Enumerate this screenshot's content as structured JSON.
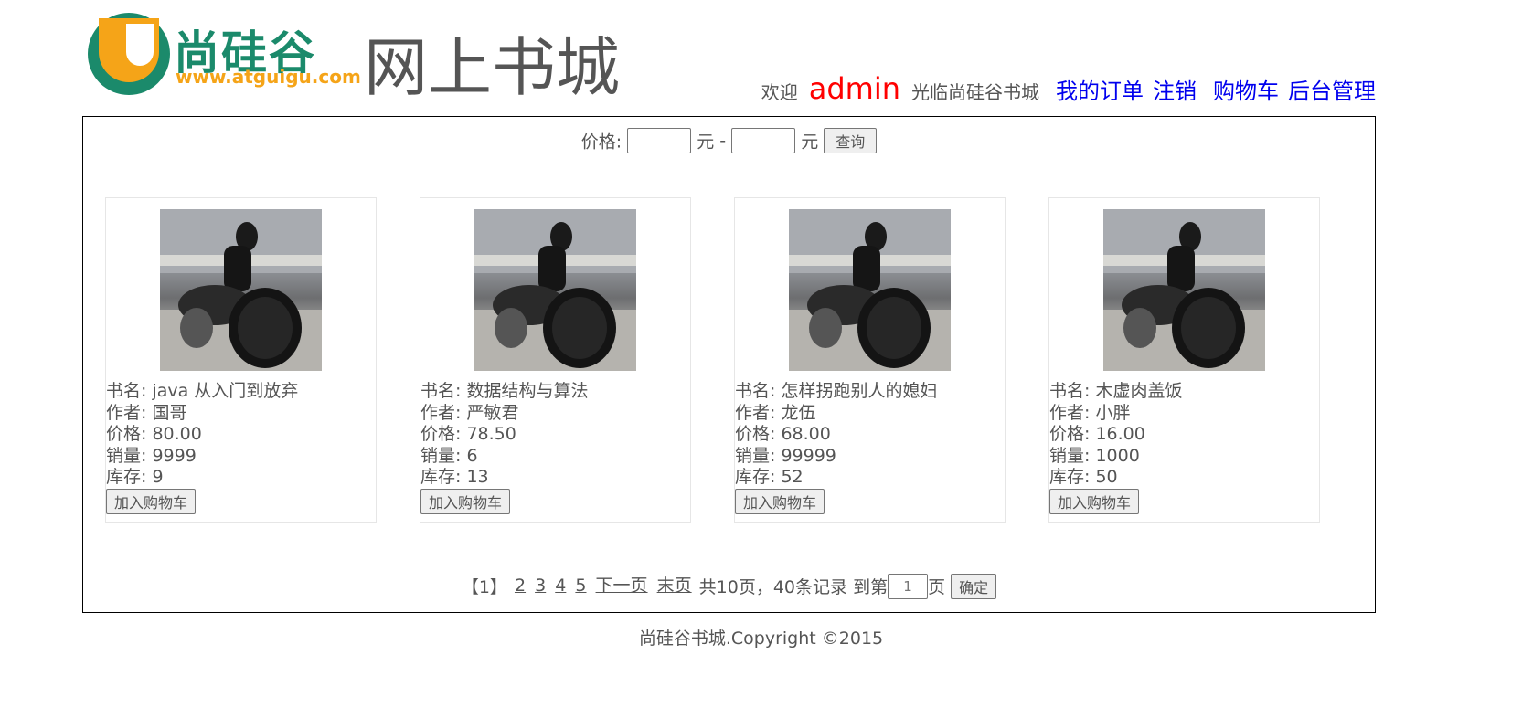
{
  "header": {
    "logo_cn": "尚硅谷",
    "logo_url": "www.atguigu.com",
    "site_title": "网上书城",
    "welcome": "欢迎",
    "username": "admin",
    "welcome_suffix": "光临尚硅谷书城",
    "links": {
      "my_orders": "我的订单",
      "logout": "注销",
      "cart": "购物车",
      "admin": "后台管理"
    },
    "colors": {
      "username": "#ff0000",
      "links": "#0000ee"
    }
  },
  "search": {
    "label": "价格:",
    "unit": "元",
    "separator": "-",
    "min_value": "",
    "max_value": "",
    "button": "查询"
  },
  "books": [
    {
      "name_label": "书名:",
      "name": "java 从入门到放弃",
      "author_label": "作者:",
      "author": "国哥",
      "price_label": "价格:",
      "price": "80.00",
      "sales_label": "销量:",
      "sales": "9999",
      "stock_label": "库存:",
      "stock": "9",
      "button": "加入购物车"
    },
    {
      "name_label": "书名:",
      "name": "数据结构与算法",
      "author_label": "作者:",
      "author": "严敏君",
      "price_label": "价格:",
      "price": "78.50",
      "sales_label": "销量:",
      "sales": "6",
      "stock_label": "库存:",
      "stock": "13",
      "button": "加入购物车"
    },
    {
      "name_label": "书名:",
      "name": "怎样拐跑别人的媳妇",
      "author_label": "作者:",
      "author": "龙伍",
      "price_label": "价格:",
      "price": "68.00",
      "sales_label": "销量:",
      "sales": "99999",
      "stock_label": "库存:",
      "stock": "52",
      "button": "加入购物车"
    },
    {
      "name_label": "书名:",
      "name": "木虚肉盖饭",
      "author_label": "作者:",
      "author": "小胖",
      "price_label": "价格:",
      "price": "16.00",
      "sales_label": "销量:",
      "sales": "1000",
      "stock_label": "库存:",
      "stock": "50",
      "button": "加入购物车"
    }
  ],
  "pager": {
    "current": "【1】",
    "pages": [
      "2",
      "3",
      "4",
      "5"
    ],
    "next": "下一页",
    "last": "末页",
    "summary": "共10页，40条记录",
    "goto_prefix": "到第",
    "goto_value": "1",
    "goto_suffix": "页",
    "confirm": "确定"
  },
  "footer": {
    "text": "尚硅谷书城.Copyright ©2015"
  }
}
